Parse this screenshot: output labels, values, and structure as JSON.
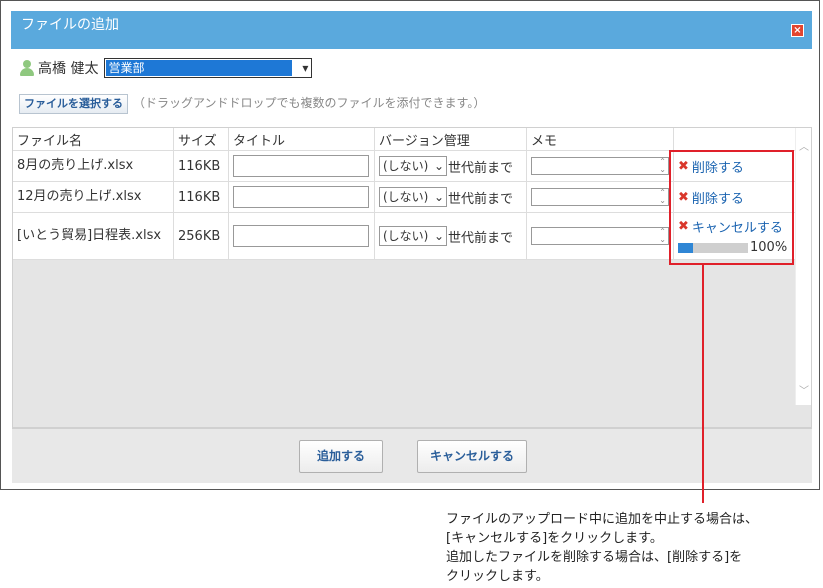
{
  "dialog": {
    "title": "ファイルの追加"
  },
  "user": {
    "name": "高橋 健太",
    "department_selected": "営業部"
  },
  "upload": {
    "select_button": "ファイルを選択する",
    "hint": "（ドラッグアンドドロップでも複数のファイルを添付できます。）"
  },
  "table": {
    "headers": [
      "ファイル名",
      "サイズ",
      "タイトル",
      "バージョン管理",
      "メモ"
    ],
    "rows": [
      {
        "file_name": "8月の売り上げ.xlsx",
        "size": "116KB",
        "version": "(しない)",
        "version_suffix": "世代前まで",
        "action": "削除する"
      },
      {
        "file_name": "12月の売り上げ.xlsx",
        "size": "116KB",
        "version": "(しない)",
        "version_suffix": "世代前まで",
        "action": "削除する"
      },
      {
        "file_name": "[いとう貿易]日程表.xlsx",
        "size": "256KB",
        "version": "(しない)",
        "version_suffix": "世代前まで",
        "action": "キャンセルする",
        "progress": 100,
        "progress_text": "100%"
      }
    ]
  },
  "footer": {
    "add_button": "追加する",
    "cancel_button": "キャンセルする"
  },
  "annotation": {
    "line1": "ファイルのアップロード中に追加を中止する場合は、",
    "line2": "[キャンセルする]をクリックします。",
    "line3": "追加したファイルを削除する場合は、[削除する]を",
    "line4": "クリックします。"
  },
  "colors": {
    "titlebar": "#5aa9dd",
    "link": "#1a63b0",
    "callout": "#e0202a",
    "progress": "#2f86d5"
  }
}
